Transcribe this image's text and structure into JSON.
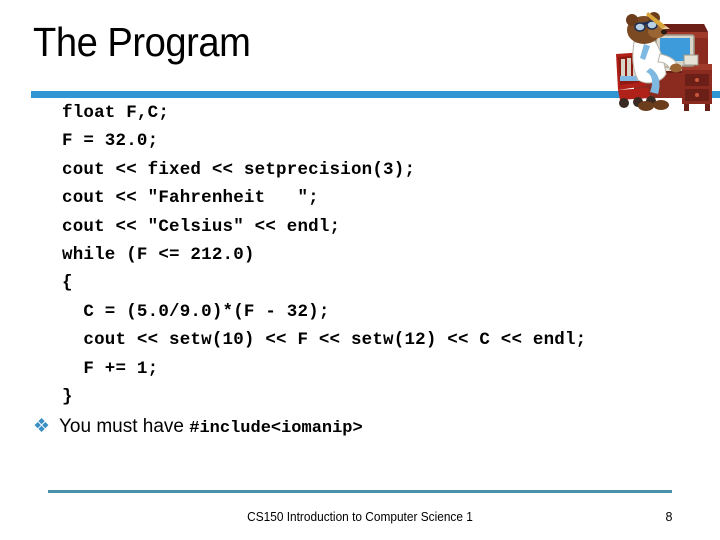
{
  "slide": {
    "title": "The Program",
    "page_number": "8",
    "footer_text": "CS150 Introduction to Computer Science 1",
    "accent_color": "#2f95d3",
    "footer_rule_color": "#4b92a8",
    "bullet_color": "#3a8fc4"
  },
  "code": {
    "lines": [
      "float F,C;",
      "F = 32.0;",
      "cout << fixed << setprecision(3);",
      "cout << \"Fahrenheit   \";",
      "cout << \"Celsius\" << endl;",
      "while (F <= 212.0)",
      "{",
      "  C = (5.0/9.0)*(F - 32);",
      "  cout << setw(10) << F << setw(12) << C << endl;",
      "  F += 1;",
      "}"
    ]
  },
  "bullet": {
    "marker": "❖",
    "marker_name": "diamond-bullet-icon",
    "text": "You must have ",
    "code": "#include<iomanip>"
  },
  "clipart": {
    "name": "bear-at-computer-desk-clipart",
    "desk_color": "#8b2b20",
    "desk_dark": "#6b1f16",
    "monitor_screen_color": "#3d9bdc",
    "monitor_case_color": "#d8d4c8",
    "bear_fur_color": "#7b4a22",
    "bear_shirt_color": "#ffffff",
    "chair_color": "#b02219",
    "accent_blue": "#7fb8e0"
  }
}
